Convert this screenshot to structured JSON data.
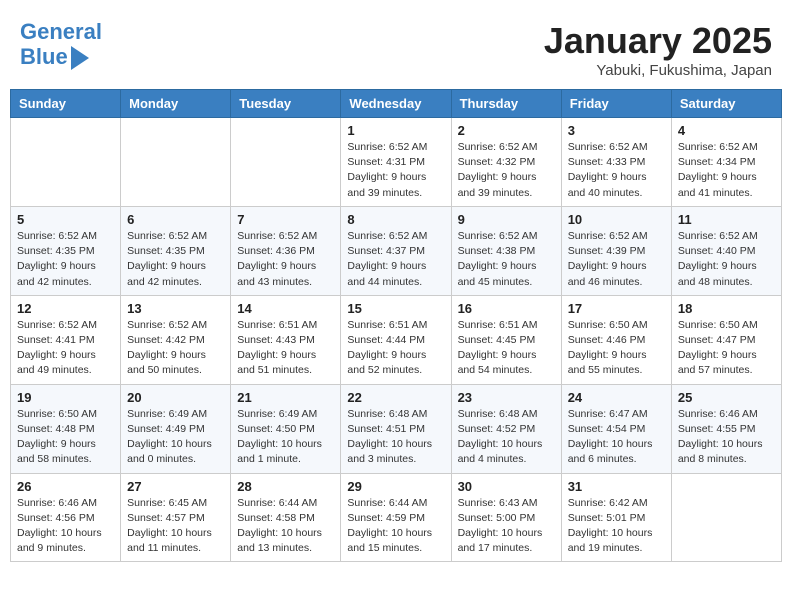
{
  "header": {
    "logo_line1": "General",
    "logo_line2": "Blue",
    "month": "January 2025",
    "location": "Yabuki, Fukushima, Japan"
  },
  "weekdays": [
    "Sunday",
    "Monday",
    "Tuesday",
    "Wednesday",
    "Thursday",
    "Friday",
    "Saturday"
  ],
  "weeks": [
    [
      {
        "day": "",
        "info": ""
      },
      {
        "day": "",
        "info": ""
      },
      {
        "day": "",
        "info": ""
      },
      {
        "day": "1",
        "info": "Sunrise: 6:52 AM\nSunset: 4:31 PM\nDaylight: 9 hours\nand 39 minutes."
      },
      {
        "day": "2",
        "info": "Sunrise: 6:52 AM\nSunset: 4:32 PM\nDaylight: 9 hours\nand 39 minutes."
      },
      {
        "day": "3",
        "info": "Sunrise: 6:52 AM\nSunset: 4:33 PM\nDaylight: 9 hours\nand 40 minutes."
      },
      {
        "day": "4",
        "info": "Sunrise: 6:52 AM\nSunset: 4:34 PM\nDaylight: 9 hours\nand 41 minutes."
      }
    ],
    [
      {
        "day": "5",
        "info": "Sunrise: 6:52 AM\nSunset: 4:35 PM\nDaylight: 9 hours\nand 42 minutes."
      },
      {
        "day": "6",
        "info": "Sunrise: 6:52 AM\nSunset: 4:35 PM\nDaylight: 9 hours\nand 42 minutes."
      },
      {
        "day": "7",
        "info": "Sunrise: 6:52 AM\nSunset: 4:36 PM\nDaylight: 9 hours\nand 43 minutes."
      },
      {
        "day": "8",
        "info": "Sunrise: 6:52 AM\nSunset: 4:37 PM\nDaylight: 9 hours\nand 44 minutes."
      },
      {
        "day": "9",
        "info": "Sunrise: 6:52 AM\nSunset: 4:38 PM\nDaylight: 9 hours\nand 45 minutes."
      },
      {
        "day": "10",
        "info": "Sunrise: 6:52 AM\nSunset: 4:39 PM\nDaylight: 9 hours\nand 46 minutes."
      },
      {
        "day": "11",
        "info": "Sunrise: 6:52 AM\nSunset: 4:40 PM\nDaylight: 9 hours\nand 48 minutes."
      }
    ],
    [
      {
        "day": "12",
        "info": "Sunrise: 6:52 AM\nSunset: 4:41 PM\nDaylight: 9 hours\nand 49 minutes."
      },
      {
        "day": "13",
        "info": "Sunrise: 6:52 AM\nSunset: 4:42 PM\nDaylight: 9 hours\nand 50 minutes."
      },
      {
        "day": "14",
        "info": "Sunrise: 6:51 AM\nSunset: 4:43 PM\nDaylight: 9 hours\nand 51 minutes."
      },
      {
        "day": "15",
        "info": "Sunrise: 6:51 AM\nSunset: 4:44 PM\nDaylight: 9 hours\nand 52 minutes."
      },
      {
        "day": "16",
        "info": "Sunrise: 6:51 AM\nSunset: 4:45 PM\nDaylight: 9 hours\nand 54 minutes."
      },
      {
        "day": "17",
        "info": "Sunrise: 6:50 AM\nSunset: 4:46 PM\nDaylight: 9 hours\nand 55 minutes."
      },
      {
        "day": "18",
        "info": "Sunrise: 6:50 AM\nSunset: 4:47 PM\nDaylight: 9 hours\nand 57 minutes."
      }
    ],
    [
      {
        "day": "19",
        "info": "Sunrise: 6:50 AM\nSunset: 4:48 PM\nDaylight: 9 hours\nand 58 minutes."
      },
      {
        "day": "20",
        "info": "Sunrise: 6:49 AM\nSunset: 4:49 PM\nDaylight: 10 hours\nand 0 minutes."
      },
      {
        "day": "21",
        "info": "Sunrise: 6:49 AM\nSunset: 4:50 PM\nDaylight: 10 hours\nand 1 minute."
      },
      {
        "day": "22",
        "info": "Sunrise: 6:48 AM\nSunset: 4:51 PM\nDaylight: 10 hours\nand 3 minutes."
      },
      {
        "day": "23",
        "info": "Sunrise: 6:48 AM\nSunset: 4:52 PM\nDaylight: 10 hours\nand 4 minutes."
      },
      {
        "day": "24",
        "info": "Sunrise: 6:47 AM\nSunset: 4:54 PM\nDaylight: 10 hours\nand 6 minutes."
      },
      {
        "day": "25",
        "info": "Sunrise: 6:46 AM\nSunset: 4:55 PM\nDaylight: 10 hours\nand 8 minutes."
      }
    ],
    [
      {
        "day": "26",
        "info": "Sunrise: 6:46 AM\nSunset: 4:56 PM\nDaylight: 10 hours\nand 9 minutes."
      },
      {
        "day": "27",
        "info": "Sunrise: 6:45 AM\nSunset: 4:57 PM\nDaylight: 10 hours\nand 11 minutes."
      },
      {
        "day": "28",
        "info": "Sunrise: 6:44 AM\nSunset: 4:58 PM\nDaylight: 10 hours\nand 13 minutes."
      },
      {
        "day": "29",
        "info": "Sunrise: 6:44 AM\nSunset: 4:59 PM\nDaylight: 10 hours\nand 15 minutes."
      },
      {
        "day": "30",
        "info": "Sunrise: 6:43 AM\nSunset: 5:00 PM\nDaylight: 10 hours\nand 17 minutes."
      },
      {
        "day": "31",
        "info": "Sunrise: 6:42 AM\nSunset: 5:01 PM\nDaylight: 10 hours\nand 19 minutes."
      },
      {
        "day": "",
        "info": ""
      }
    ]
  ]
}
